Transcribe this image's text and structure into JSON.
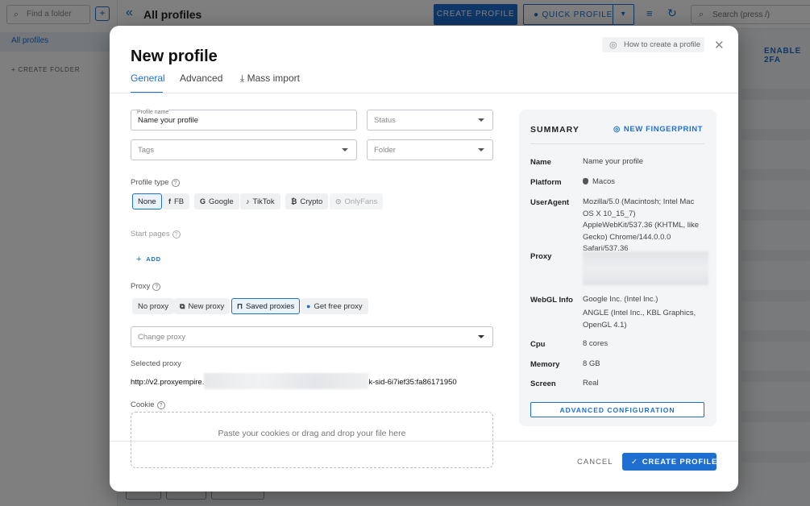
{
  "app": {
    "find_folder_placeholder": "Find a folder",
    "all_profiles_nav": "All profiles",
    "create_folder": "CREATE FOLDER",
    "page_title": "All profiles",
    "create_profile_btn": "CREATE PROFILE",
    "quick_profile_btn": "QUICK PROFILE",
    "search_placeholder": "Search (press /)",
    "enable_2fa": "ENABLE 2FA"
  },
  "modal": {
    "title": "New profile",
    "help_link": "How to create a profile",
    "tabs": [
      {
        "label": "General",
        "active": true
      },
      {
        "label": "Advanced",
        "active": false
      },
      {
        "label": "Mass import",
        "active": false
      }
    ],
    "profile_name_label": "Profile name",
    "profile_name_value": "Name your profile",
    "status_placeholder": "Status",
    "tags_placeholder": "Tags",
    "folder_placeholder": "Folder",
    "profile_type_label": "Profile type",
    "profile_types": [
      {
        "label": "None",
        "icon": "",
        "state": "selected"
      },
      {
        "label": "FB",
        "icon": "f",
        "state": "normal"
      },
      {
        "label": "Google",
        "icon": "G",
        "state": "normal"
      },
      {
        "label": "TikTok",
        "icon": "♪",
        "state": "normal"
      },
      {
        "label": "Crypto",
        "icon": "₿",
        "state": "normal"
      },
      {
        "label": "OnlyFans",
        "icon": "⊙",
        "state": "disabled"
      }
    ],
    "start_pages_label": "Start pages",
    "add_label": "ADD",
    "proxy_label": "Proxy",
    "proxy_options": [
      {
        "label": "No proxy",
        "state": "normal"
      },
      {
        "label": "New proxy",
        "state": "normal"
      },
      {
        "label": "Saved proxies",
        "state": "selected"
      },
      {
        "label": "Get free proxy",
        "state": "normal"
      }
    ],
    "change_proxy_placeholder": "Change proxy",
    "selected_proxy_label": "Selected proxy",
    "selected_proxy_prefix": "http://v2.proxyempire.",
    "selected_proxy_suffix": "k-sid-6i7ief35:fa86171950",
    "cookie_label": "Cookie",
    "cookie_drop_text": "Paste your cookies or drag and drop your file here",
    "cancel": "CANCEL",
    "create_profile": "CREATE PROFILE"
  },
  "summary": {
    "title": "SUMMARY",
    "new_fingerprint": "NEW FINGERPRINT",
    "rows": {
      "name": {
        "key": "Name",
        "value": "Name your profile"
      },
      "platform": {
        "key": "Platform",
        "value": "Macos"
      },
      "useragent": {
        "key": "UserAgent",
        "value": "Mozilla/5.0 (Macintosh; Intel Mac OS X 10_15_7) AppleWebKit/537.36 (KHTML, like Gecko) Chrome/144.0.0.0 Safari/537.36"
      },
      "proxy": {
        "key": "Proxy"
      },
      "webgl": {
        "key": "WebGL Info",
        "vendor": "Google Inc. (Intel Inc.)",
        "renderer": "ANGLE (Intel Inc., KBL Graphics, OpenGL 4.1)"
      },
      "cpu": {
        "key": "Cpu",
        "value": "8 cores"
      },
      "memory": {
        "key": "Memory",
        "value": "8 GB"
      },
      "screen": {
        "key": "Screen",
        "value": "Real"
      }
    },
    "advanced_config": "ADVANCED CONFIGURATION"
  },
  "colors": {
    "accent": "#1f6fd1",
    "overlay": "rgba(0,0,0,0.5)"
  }
}
